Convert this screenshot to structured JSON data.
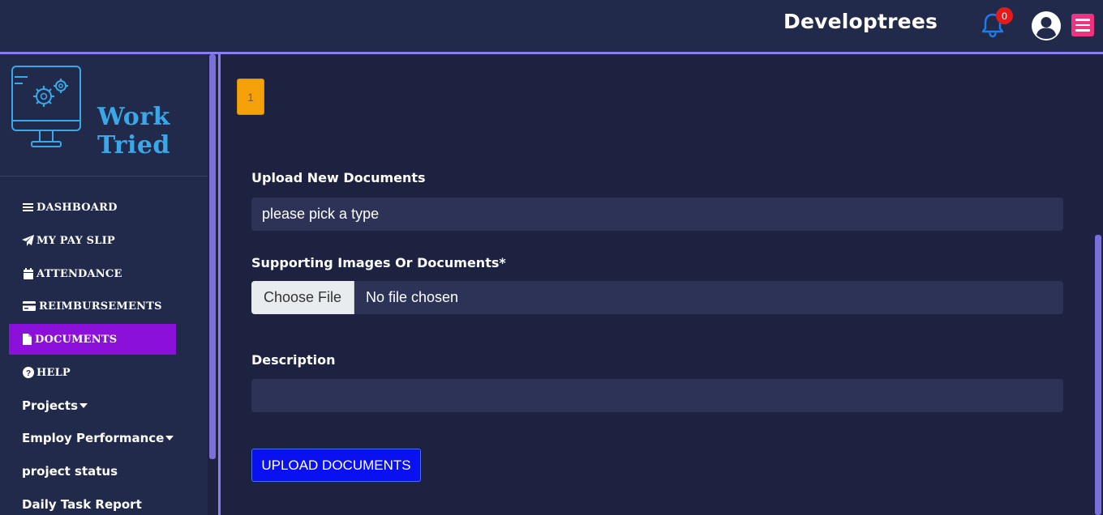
{
  "header": {
    "brand": "Developtrees",
    "notification_count": "0",
    "icons": {
      "bell": "bell-icon",
      "avatar": "user-circle-icon",
      "menu": "hamburger-menu-icon"
    }
  },
  "sidebar": {
    "logo_text": "Work Tried",
    "items": [
      {
        "label": "DASHBOARD",
        "icon": "bars-icon"
      },
      {
        "label": "MY PAY SLIP",
        "icon": "paper-plane-icon"
      },
      {
        "label": "ATTENDANCE",
        "icon": "calendar-icon"
      },
      {
        "label": "REIMBURSEMENTS",
        "icon": "credit-card-icon"
      },
      {
        "label": "DOCUMENTS",
        "icon": "file-icon",
        "active": true
      },
      {
        "label": "HELP",
        "icon": "question-circle-icon"
      },
      {
        "label": "Projects",
        "icon": "caret-down-icon"
      },
      {
        "label": "Employ Performance",
        "icon": "caret-down-icon"
      },
      {
        "label": "project status"
      },
      {
        "label": "Daily Task Report"
      }
    ]
  },
  "main": {
    "step": "1",
    "upload_title": "Upload New Documents",
    "type_select_value": "please pick a type",
    "supporting_label": "Supporting Images Or Documents*",
    "choose_file_label": "Choose File",
    "file_status": "No file chosen",
    "description_label": "Description",
    "description_value": "",
    "upload_button": "UPLOAD DOCUMENTS"
  },
  "colors": {
    "background": "#1c2240",
    "panel": "#222a4b",
    "accent_purple": "#8b10d9",
    "step_orange": "#f5a10a",
    "button_blue": "#0a11f0",
    "menu_pink": "#f0337e",
    "bell_blue": "#1e7cf0"
  }
}
